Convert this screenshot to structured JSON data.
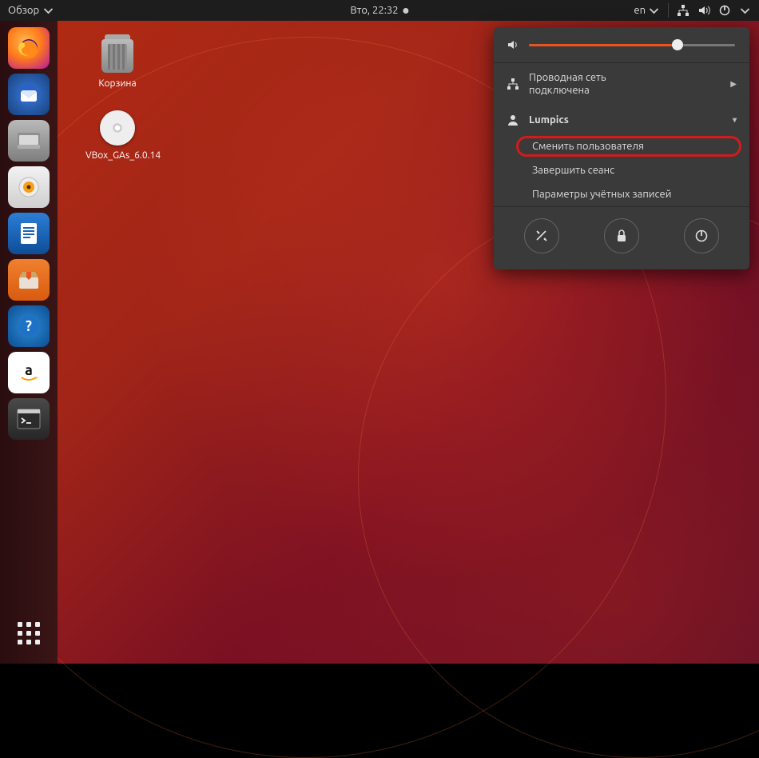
{
  "topbar": {
    "activities": "Обзор",
    "clock": "Вто, 22:32",
    "lang": "en"
  },
  "desktop_icons": {
    "trash": "Корзина",
    "cd": "VBox_GAs_6.0.14"
  },
  "dock": {
    "apps": [
      "firefox",
      "thunderbird",
      "files",
      "rhythmbox",
      "writer",
      "software",
      "help",
      "amazon",
      "terminal"
    ]
  },
  "popover": {
    "network_line1": "Проводная сеть",
    "network_line2": "подключена",
    "user": "Lumpics",
    "switch_user": "Сменить пользователя",
    "logout": "Завершить сеанс",
    "account_settings": "Параметры учётных записей",
    "volume_percent": 72
  }
}
